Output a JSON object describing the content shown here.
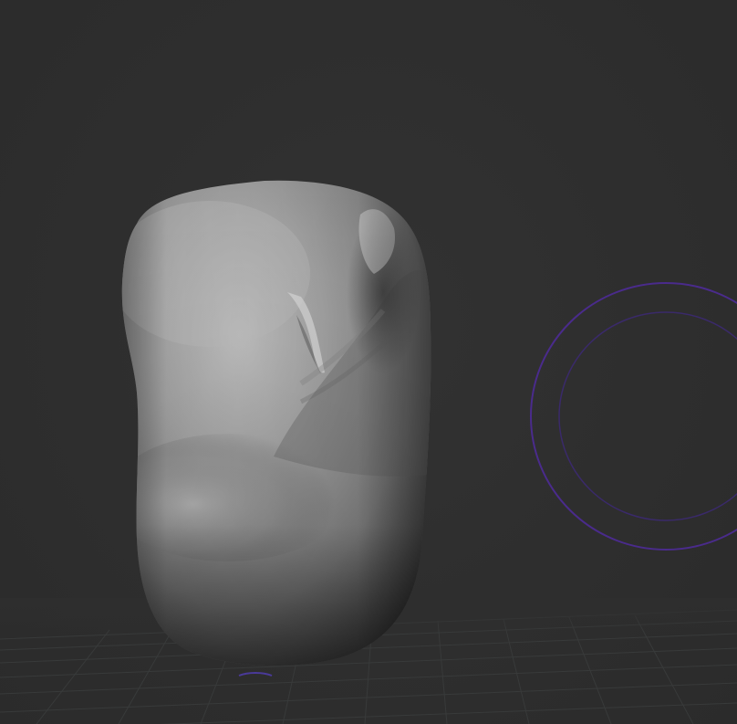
{
  "viewport": {
    "background_color": "#2e2e2e",
    "grid_color": "#3a3c3c",
    "mesh_colors": {
      "highlight": "#d8d8d8",
      "base": "#9a9a9a",
      "shadow": "#3c3c3c"
    },
    "brush_cursor": {
      "outer_ring_color": "#4a2b8c",
      "inner_ring_color": "#3a2a6a",
      "icon": "brush-ring-icon"
    }
  }
}
